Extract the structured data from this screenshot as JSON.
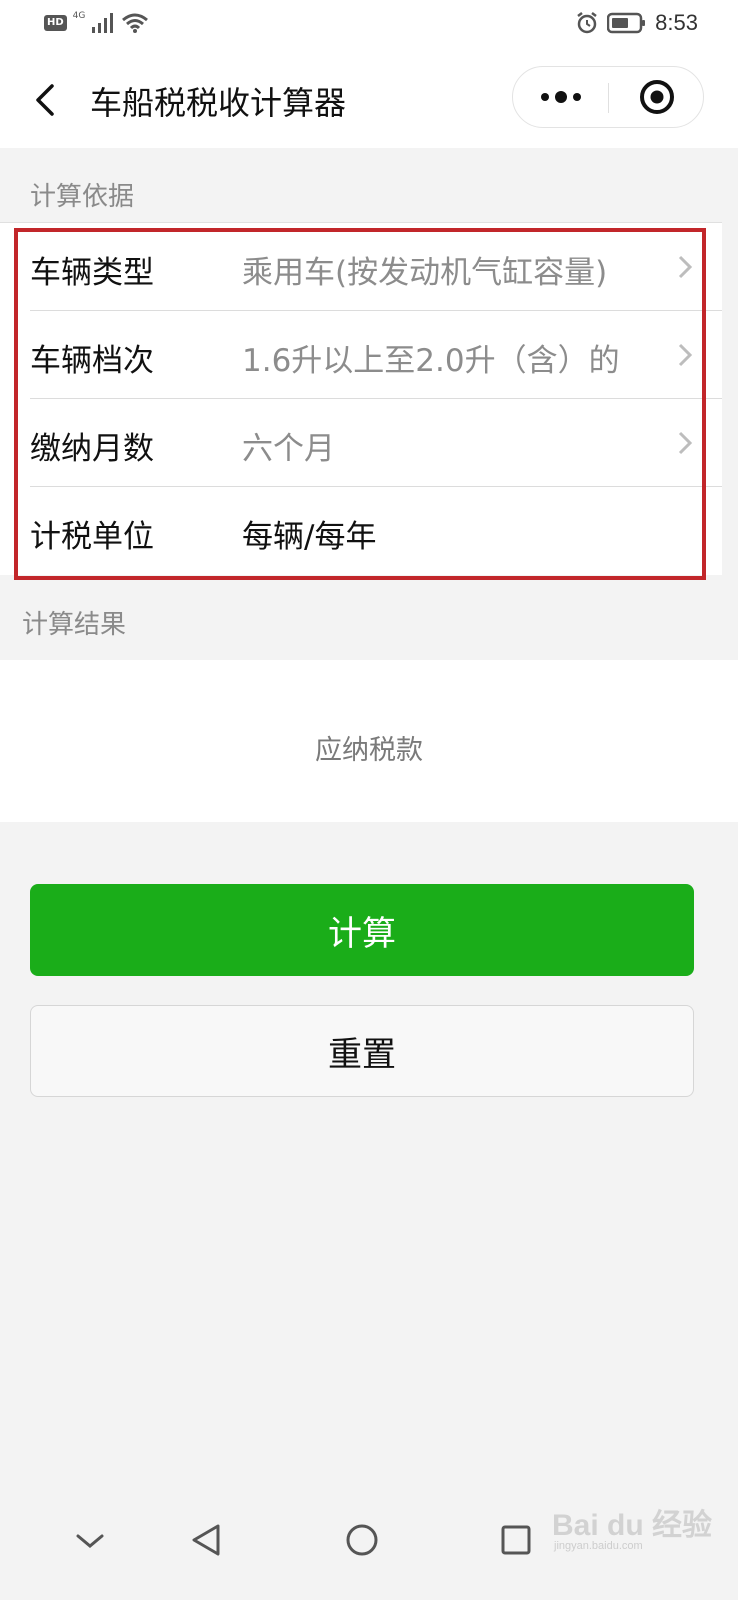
{
  "status_bar": {
    "hd_badge": "HD",
    "network": "4G",
    "time": "8:53",
    "icons": [
      "signal-icon",
      "wifi-icon",
      "alarm-icon",
      "battery-icon"
    ]
  },
  "nav": {
    "title": "车船税税收计算器",
    "icons": [
      "back-arrow-icon",
      "more-dots-icon",
      "close-circle-icon"
    ]
  },
  "basis": {
    "section_title": "计算依据",
    "rows": [
      {
        "label": "车辆类型",
        "value": "乘用车(按发动机气缸容量)"
      },
      {
        "label": "车辆档次",
        "value": "1.6升以上至2.0升（含）的"
      },
      {
        "label": "缴纳月数",
        "value": "六个月"
      },
      {
        "label": "计税单位",
        "value": "每辆/每年"
      }
    ]
  },
  "result": {
    "section_title": "计算结果",
    "tax_label": "应纳税款"
  },
  "buttons": {
    "calculate": "计算",
    "reset": "重置"
  },
  "system_nav": {
    "icons": [
      "chevron-down-icon",
      "back-triangle-icon",
      "home-circle-icon",
      "recents-square-icon"
    ]
  },
  "watermark": {
    "brand": "Bai du 经验",
    "sub": "jingyan.baidu.com"
  },
  "colors": {
    "primary_green": "#1aad19",
    "highlight_red": "#c2262a",
    "muted_text": "#8c8c8c"
  }
}
